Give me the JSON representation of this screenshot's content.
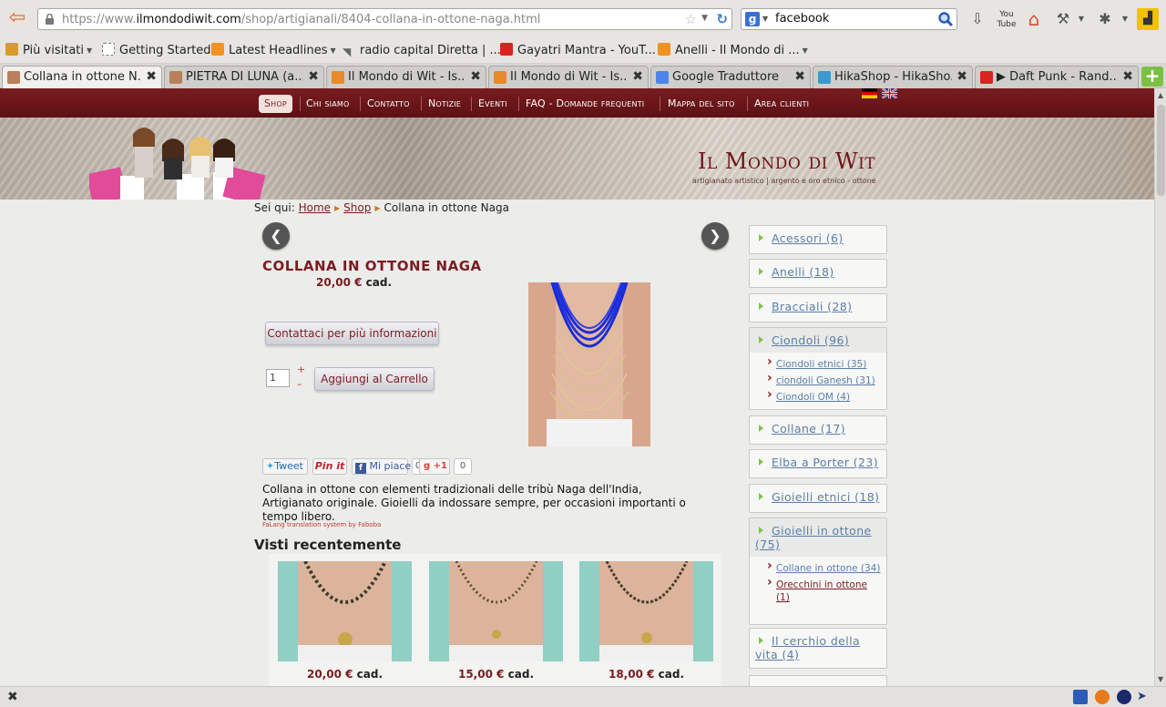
{
  "browser": {
    "url_prefix": "https://www.",
    "url_domain": "ilmondodiwit.com",
    "url_path": "/shop/artigianali/8404-collana-in-ottone-naga.html",
    "search_engine_icon": "g-icon",
    "search_value": "facebook"
  },
  "bookmarks": [
    {
      "label": "Più visitati",
      "icon": "folder-icon",
      "color": "#d89a2a",
      "dropdown": true
    },
    {
      "label": "Getting Started",
      "icon": "page-icon",
      "color": "#ffffff",
      "dropdown": false
    },
    {
      "label": "Latest Headlines",
      "icon": "rss-icon",
      "color": "#f29222",
      "dropdown": true
    },
    {
      "label": "radio capital Diretta | ...",
      "icon": "radio-icon",
      "color": "#8a8a8a",
      "dropdown": false
    },
    {
      "label": "Gayatri Mantra - YouT...",
      "icon": "youtube-icon",
      "color": "#d8241f",
      "dropdown": false
    },
    {
      "label": "Anelli - Il Mondo di ...",
      "icon": "rss-icon",
      "color": "#f29222",
      "dropdown": true
    }
  ],
  "tabs": [
    {
      "title": "Collana in ottone N...",
      "color": "#b9805a",
      "active": true
    },
    {
      "title": "PIETRA DI LUNA (a...",
      "color": "#b9805a",
      "active": false
    },
    {
      "title": "Il Mondo di Wit - Is...",
      "color": "#e78a2b",
      "active": false
    },
    {
      "title": "Il Mondo di Wit - Is...",
      "color": "#e78a2b",
      "active": false
    },
    {
      "title": "Google Traduttore",
      "color": "#4a86e8",
      "active": false
    },
    {
      "title": "HikaShop - HikaSho...",
      "color": "#3a9ad0",
      "active": false
    },
    {
      "title": "▶ Daft Punk - Rand...",
      "color": "#d8241f",
      "active": false
    }
  ],
  "nav": {
    "items": [
      "Shop",
      "Chi siamo",
      "Contatto",
      "Notizie",
      "Eventi",
      "FAQ - Domande frequenti",
      "Mappa del sito",
      "Area clienti"
    ],
    "active": "Shop"
  },
  "banner": {
    "title": "Il Mondo di Wit",
    "tagline": "artigianato artistico | argento e oro etnico - ottone"
  },
  "breadcrumb": {
    "label": "Sei qui:",
    "home": "Home",
    "shop": "Shop",
    "current": "Collana in ottone Naga"
  },
  "product": {
    "title": "COLLANA IN OTTONE NAGA",
    "price": "20,00 €",
    "unit": "cad.",
    "contact_button": "Contattaci per più informazioni",
    "quantity": "1",
    "plus": "+",
    "minus": "–",
    "add_to_cart": "Aggiungi al Carrello",
    "description": "Collana in ottone  con elementi tradizionali delle tribù Naga dell'India, Artigianato originale. Gioielli da indossare sempre, per occasioni importanti o tempo libero.",
    "falang": "FaLang translation system by Faboba"
  },
  "social": {
    "tweet": "Tweet",
    "pinit": "Pin it",
    "like": "Mi piace",
    "like_count": "0",
    "gplus": "+1",
    "gplus_count": "0"
  },
  "recent": {
    "title": "Visti recentemente",
    "items": [
      {
        "price": "20,00 €",
        "unit": "cad."
      },
      {
        "price": "15,00 €",
        "unit": "cad."
      },
      {
        "price": "18,00 €",
        "unit": "cad."
      }
    ]
  },
  "categories": [
    {
      "label": "Acessori (6)"
    },
    {
      "label": "Anelli (18)"
    },
    {
      "label": "Bracciali (28)"
    },
    {
      "label": "Ciondoli (96)",
      "subs": [
        "Ciondoli etnici (35)",
        "ciondoli Ganesh (31)",
        "Ciondoli OM (4)"
      ]
    },
    {
      "label": "Collane (17)"
    },
    {
      "label": "Elba a Porter (23)"
    },
    {
      "label": "Gioielli etnici (18)"
    },
    {
      "label": "Gioielli in ottone (75)",
      "subs": [
        "Collane in ottone (34)",
        "Orecchini in ottone (1)"
      ]
    },
    {
      "label": "Il cerchio della vita (4)"
    }
  ],
  "colors": {
    "brand": "#7a1c20",
    "link": "#5a7fa8",
    "accent_green": "#7fc44d"
  }
}
